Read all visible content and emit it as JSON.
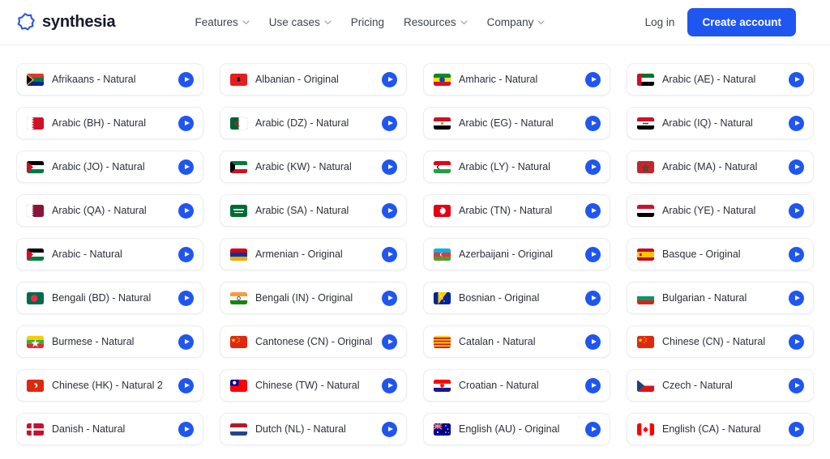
{
  "header": {
    "brand_name": "synthesia",
    "brand_icon": "synthesia-logo-icon",
    "nav": [
      {
        "label": "Features",
        "has_caret": true
      },
      {
        "label": "Use cases",
        "has_caret": true
      },
      {
        "label": "Pricing",
        "has_caret": false
      },
      {
        "label": "Resources",
        "has_caret": true
      },
      {
        "label": "Company",
        "has_caret": true
      }
    ],
    "login_label": "Log in",
    "cta_label": "Create account",
    "cta_color": "#1f56f0"
  },
  "voices": [
    {
      "label": "Afrikaans - Natural",
      "flag": "za"
    },
    {
      "label": "Albanian - Original",
      "flag": "al"
    },
    {
      "label": "Amharic - Natural",
      "flag": "et"
    },
    {
      "label": "Arabic (AE) - Natural",
      "flag": "ae"
    },
    {
      "label": "Arabic (BH) - Natural",
      "flag": "bh"
    },
    {
      "label": "Arabic (DZ) - Natural",
      "flag": "dz"
    },
    {
      "label": "Arabic (EG) - Natural",
      "flag": "eg"
    },
    {
      "label": "Arabic (IQ) - Natural",
      "flag": "iq"
    },
    {
      "label": "Arabic (JO) - Natural",
      "flag": "jo"
    },
    {
      "label": "Arabic (KW) - Natural",
      "flag": "kw"
    },
    {
      "label": "Arabic (LY) - Natural",
      "flag": "ly"
    },
    {
      "label": "Arabic (MA) - Natural",
      "flag": "ma"
    },
    {
      "label": "Arabic (QA) - Natural",
      "flag": "qa"
    },
    {
      "label": "Arabic (SA) - Natural",
      "flag": "sa"
    },
    {
      "label": "Arabic (TN) - Natural",
      "flag": "tn"
    },
    {
      "label": "Arabic (YE) - Natural",
      "flag": "ye"
    },
    {
      "label": "Arabic - Natural",
      "flag": "ps"
    },
    {
      "label": "Armenian - Original",
      "flag": "am"
    },
    {
      "label": "Azerbaijani - Original",
      "flag": "az"
    },
    {
      "label": "Basque - Original",
      "flag": "es"
    },
    {
      "label": "Bengali (BD) - Natural",
      "flag": "bd"
    },
    {
      "label": "Bengali (IN) - Original",
      "flag": "in"
    },
    {
      "label": "Bosnian - Original",
      "flag": "ba"
    },
    {
      "label": "Bulgarian - Natural",
      "flag": "bg"
    },
    {
      "label": "Burmese - Natural",
      "flag": "mm"
    },
    {
      "label": "Cantonese (CN) - Original",
      "flag": "cn"
    },
    {
      "label": "Catalan - Natural",
      "flag": "ct"
    },
    {
      "label": "Chinese (CN) - Natural",
      "flag": "cn"
    },
    {
      "label": "Chinese (HK) - Natural 2",
      "flag": "hk"
    },
    {
      "label": "Chinese (TW) - Natural",
      "flag": "tw"
    },
    {
      "label": "Croatian - Natural",
      "flag": "hr"
    },
    {
      "label": "Czech - Natural",
      "flag": "cz"
    },
    {
      "label": "Danish - Natural",
      "flag": "dk"
    },
    {
      "label": "Dutch (NL) - Natural",
      "flag": "nl"
    },
    {
      "label": "English (AU) - Original",
      "flag": "au"
    },
    {
      "label": "English (CA) - Natural",
      "flag": "ca"
    }
  ],
  "play_button_icon": "play-icon"
}
